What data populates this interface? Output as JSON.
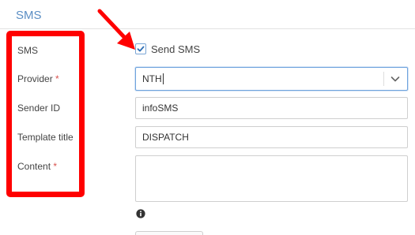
{
  "section": {
    "title": "SMS"
  },
  "form": {
    "sms": {
      "label": "SMS",
      "checkbox_label": "Send SMS",
      "checked": true
    },
    "provider": {
      "label": "Provider",
      "required_mark": "*",
      "value": "NTH"
    },
    "sender_id": {
      "label": "Sender ID",
      "value": "infoSMS"
    },
    "template_title": {
      "label": "Template title",
      "value": "DISPATCH"
    },
    "content": {
      "label": "Content",
      "required_mark": "*",
      "value": ""
    }
  },
  "icons": {
    "checkbox": "check-icon",
    "select_toggle": "chevron-down-icon",
    "info": "info-icon"
  },
  "colors": {
    "accent": "#5b8ec4",
    "required": "#d9534f",
    "annotation": "#ff0000",
    "focus_border": "#6fa3dd"
  }
}
